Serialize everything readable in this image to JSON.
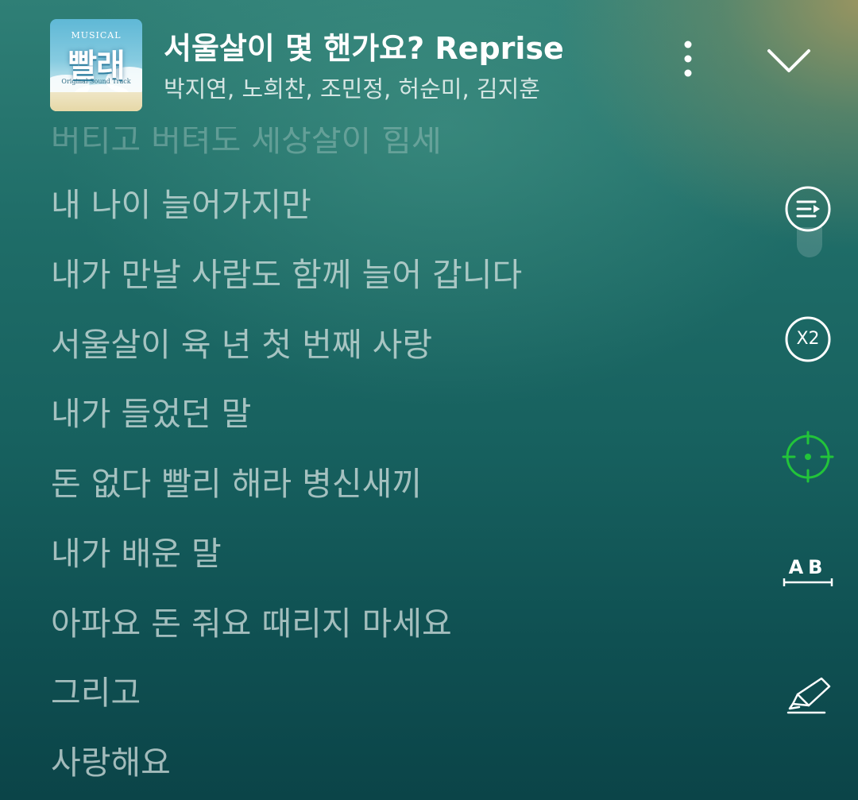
{
  "album": {
    "label_small": "MUSICAL",
    "title": "빨래",
    "subtitle": "Original Sound Track"
  },
  "song": {
    "title": "서울살이 몇 핸가요? Reprise",
    "artists": "박지연, 노희찬, 조민정, 허순미, 김지훈"
  },
  "lyrics": {
    "partial_line": "버티고 버텨도 세상살이 힘세",
    "lines": [
      "내 나이 늘어가지만",
      "내가 만날 사람도 함께 늘어 갑니다",
      "서울살이 육 년 첫 번째 사랑",
      "내가 들었던 말",
      "돈 없다 빨리 해라 병신새끼",
      "내가 배운 말",
      "아파요 돈 줘요 때리지 마세요",
      "그리고",
      "사랑해요"
    ]
  },
  "controls": {
    "speed_label": "X2",
    "ab_label": "AB",
    "icons": [
      "more-vertical-icon",
      "chevron-down-icon",
      "lyrics-playlist-icon",
      "speed-icon",
      "crosshair-locate-icon",
      "ab-repeat-icon",
      "highlighter-pen-icon"
    ],
    "accent_color": "#22c43a"
  }
}
